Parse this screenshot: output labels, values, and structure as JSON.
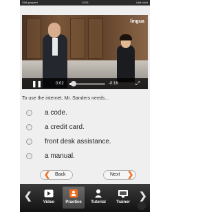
{
  "status_bar": {
    "carrier": "SIM gesperrt",
    "time": "12:03",
    "right": "Lädt nicht"
  },
  "video": {
    "logo": "lingua",
    "current_time": "0:02",
    "remaining_time": "-0:16",
    "progress": 0.11,
    "pause_icon": "pause-icon",
    "fullscreen_icon": "fullscreen-icon"
  },
  "question": "To use the internet, Mr. Sanders needs...",
  "options": [
    "a code.",
    "a credit card.",
    "front desk assistance.",
    "a manual."
  ],
  "buttons": {
    "back": "Back",
    "next": "Next"
  },
  "tabs": [
    {
      "label": "Video",
      "icon": "video-icon",
      "active": false
    },
    {
      "label": "Practice",
      "icon": "practice-icon",
      "active": true
    },
    {
      "label": "Tutorial",
      "icon": "tutorial-icon",
      "active": false
    },
    {
      "label": "Trainer",
      "icon": "trainer-icon",
      "active": false
    }
  ],
  "colors": {
    "accent": "#f26b1d",
    "tabbar": "#1e1e1e",
    "background": "#efeff0"
  }
}
